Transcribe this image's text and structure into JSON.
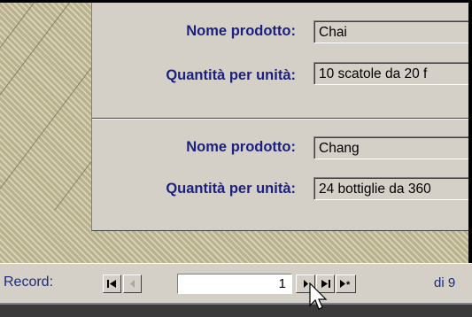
{
  "records": [
    {
      "name_label": "Nome prodotto:",
      "name_value": "Chai",
      "qty_label": "Quantità per unità:",
      "qty_value": "10 scatole da 20 f"
    },
    {
      "name_label": "Nome prodotto:",
      "name_value": "Chang",
      "qty_label": "Quantità per unità:",
      "qty_value": "24 bottiglie da 360"
    }
  ],
  "nav": {
    "label": "Record:",
    "current": "1",
    "total_text": "di 9",
    "buttons": {
      "first": "first-record-icon",
      "prev": "previous-record-icon",
      "next": "next-record-icon",
      "last": "last-record-icon",
      "new": "new-record-icon"
    }
  },
  "colors": {
    "label_color": "#1b1f80",
    "face": "#d4d0c8",
    "hatch_background": "#b9b08e"
  }
}
